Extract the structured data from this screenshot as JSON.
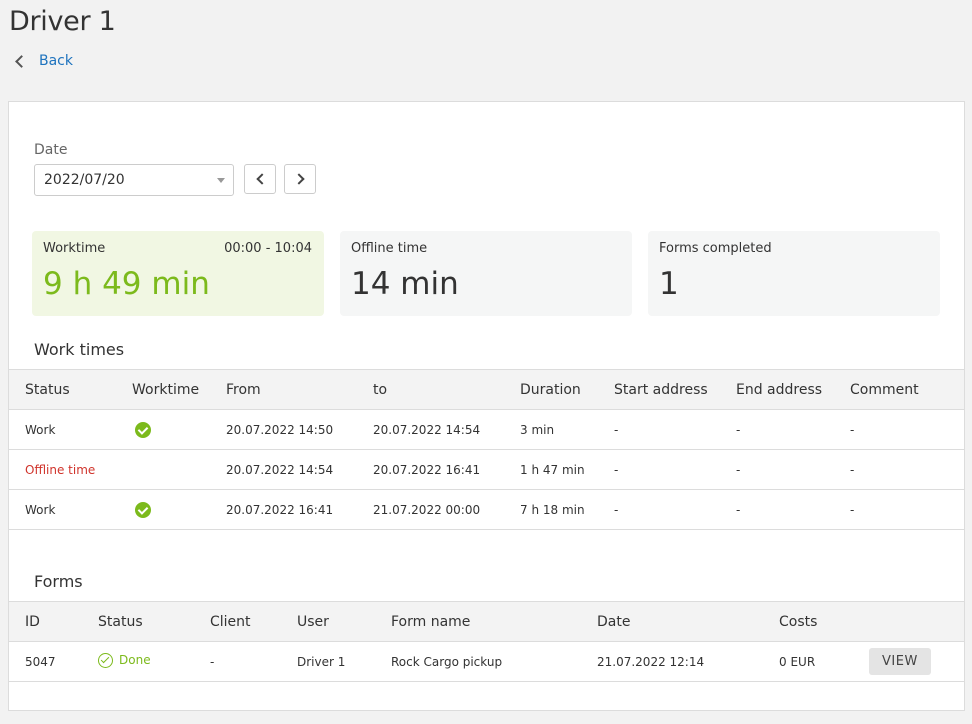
{
  "page": {
    "title": "Driver 1",
    "back_label": "Back"
  },
  "date": {
    "label": "Date",
    "value": "2022/07/20"
  },
  "stats": {
    "worktime": {
      "label": "Worktime",
      "range": "00:00 - 10:04",
      "value": "9 h 49 min"
    },
    "offline": {
      "label": "Offline time",
      "value": "14 min"
    },
    "forms": {
      "label": "Forms completed",
      "value": "1"
    }
  },
  "work_times": {
    "title": "Work times",
    "columns": [
      "Status",
      "Worktime",
      "From",
      "to",
      "Duration",
      "Start address",
      "End address",
      "Comment"
    ],
    "rows": [
      {
        "status": "Work",
        "worktime": true,
        "from": "20.07.2022 14:50",
        "to": "20.07.2022 14:54",
        "duration": "3 min",
        "start": "-",
        "end": "-",
        "comment": "-"
      },
      {
        "status": "Offline time",
        "worktime": false,
        "from": "20.07.2022 14:54",
        "to": "20.07.2022 16:41",
        "duration": "1 h 47 min",
        "start": "-",
        "end": "-",
        "comment": "-"
      },
      {
        "status": "Work",
        "worktime": true,
        "from": "20.07.2022 16:41",
        "to": "21.07.2022 00:00",
        "duration": "7 h 18 min",
        "start": "-",
        "end": "-",
        "comment": "-"
      }
    ]
  },
  "forms": {
    "title": "Forms",
    "columns": [
      "ID",
      "Status",
      "Client",
      "User",
      "Form name",
      "Date",
      "Costs",
      ""
    ],
    "rows": [
      {
        "id": "5047",
        "status": "Done",
        "client": "-",
        "user": "Driver 1",
        "form_name": "Rock Cargo pickup",
        "date": "21.07.2022 12:14",
        "costs": "0 EUR",
        "action": "VIEW"
      }
    ]
  },
  "colors": {
    "accent": "#7cba1c",
    "link": "#1e73be",
    "offline": "#d0342c"
  }
}
